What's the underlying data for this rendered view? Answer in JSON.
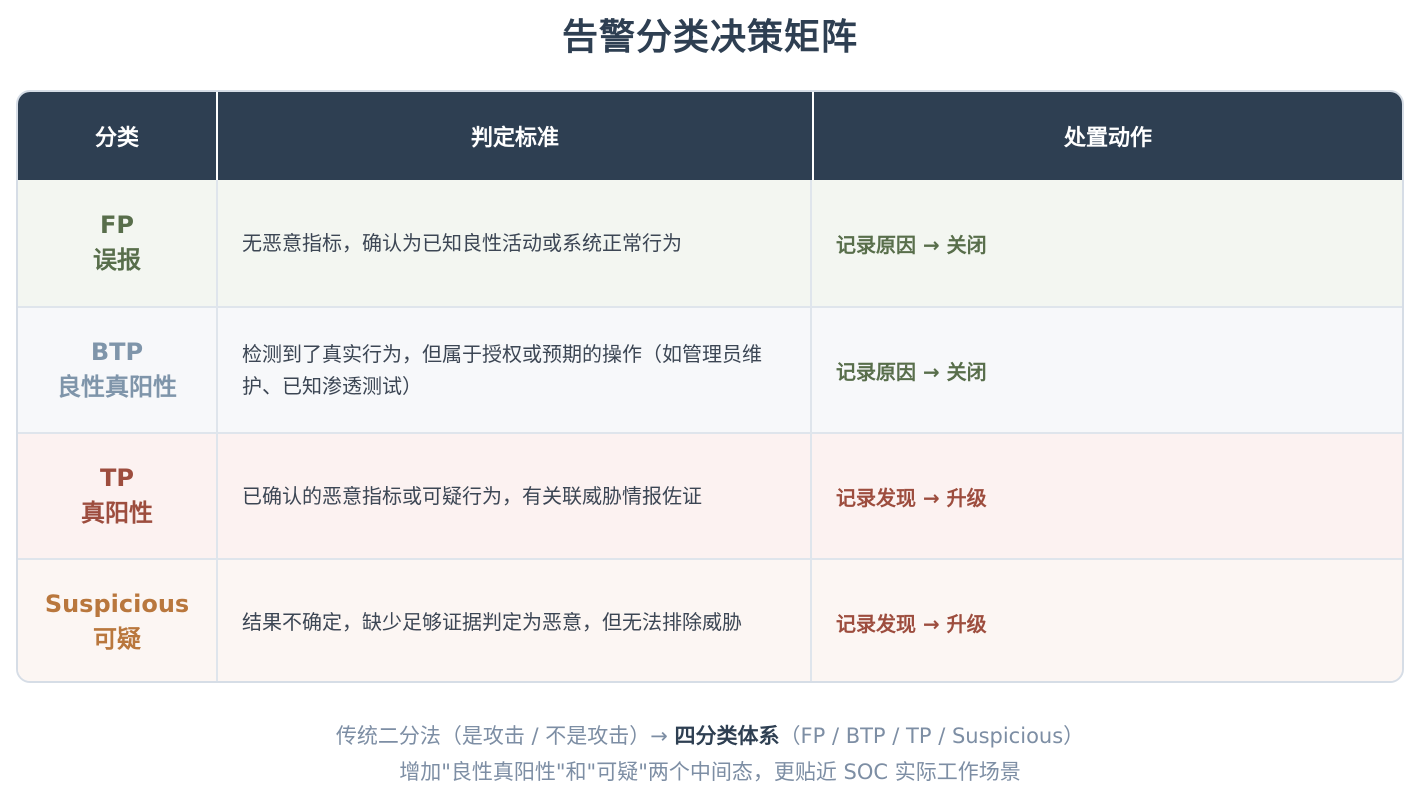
{
  "title": "告警分类决策矩阵",
  "colors": {
    "header_bg": "#2e3f52",
    "fp": "#586e4b",
    "btp": "#7f95aa",
    "tp": "#9d4d3e",
    "suspicious": "#b9773d"
  },
  "table": {
    "headers": [
      "分类",
      "判定标准",
      "处置动作"
    ],
    "rows": [
      {
        "code": "FP",
        "name": "误报",
        "criteria": "无恶意指标，确认为已知良性活动或系统正常行为",
        "action": "记录原因 → 关闭"
      },
      {
        "code": "BTP",
        "name": "良性真阳性",
        "criteria": "检测到了真实行为，但属于授权或预期的操作（如管理员维护、已知渗透测试）",
        "action": "记录原因 → 关闭"
      },
      {
        "code": "TP",
        "name": "真阳性",
        "criteria": "已确认的恶意指标或可疑行为，有关联威胁情报佐证",
        "action": "记录发现 → 升级"
      },
      {
        "code": "Suspicious",
        "name": "可疑",
        "criteria": "结果不确定，缺少足够证据判定为恶意，但无法排除威胁",
        "action": "记录发现 → 升级"
      }
    ]
  },
  "footer": {
    "line1_prefix": "传统二分法（是攻击 / 不是攻击）→ ",
    "line1_bold": "四分类体系",
    "line1_suffix": "（FP / BTP / TP / Suspicious）",
    "line2": "增加\"良性真阳性\"和\"可疑\"两个中间态，更贴近 SOC 实际工作场景"
  }
}
